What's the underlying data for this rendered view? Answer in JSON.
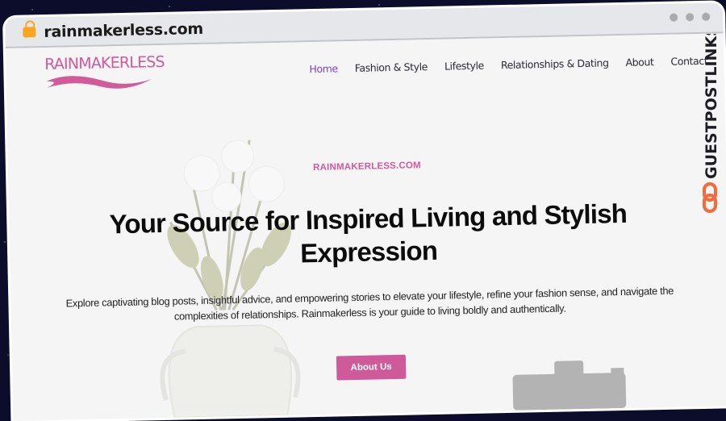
{
  "browser": {
    "url": "rainmakerless.com",
    "lock_icon": "lock-icon",
    "window_controls": [
      "dot",
      "dot",
      "dot"
    ]
  },
  "site": {
    "logo_text": "RAINMAKERLESS",
    "nav": [
      {
        "label": "Home",
        "active": true
      },
      {
        "label": "Fashion & Style",
        "active": false
      },
      {
        "label": "Lifestyle",
        "active": false
      },
      {
        "label": "Relationships & Dating",
        "active": false
      },
      {
        "label": "About",
        "active": false
      },
      {
        "label": "Contact",
        "active": false
      }
    ]
  },
  "hero": {
    "eyebrow": "RAINMAKERLESS.COM",
    "title": "Your Source for Inspired Living and Stylish Expression",
    "description": "Explore captivating blog posts, insightful advice, and empowering stories to elevate your lifestyle, refine your fashion sense, and navigate the complexities of relationships. Rainmakerless is your guide to living boldly and authentically.",
    "cta_label": "About Us"
  },
  "watermark": {
    "text": "GUESTPOSTLINKS",
    "icon": "chain-link-icon"
  },
  "colors": {
    "brand_pink": "#cf5a9a",
    "nav_active": "#7b3fd0",
    "lock": "#f6a623",
    "watermark_accent": "#f26b3a"
  }
}
